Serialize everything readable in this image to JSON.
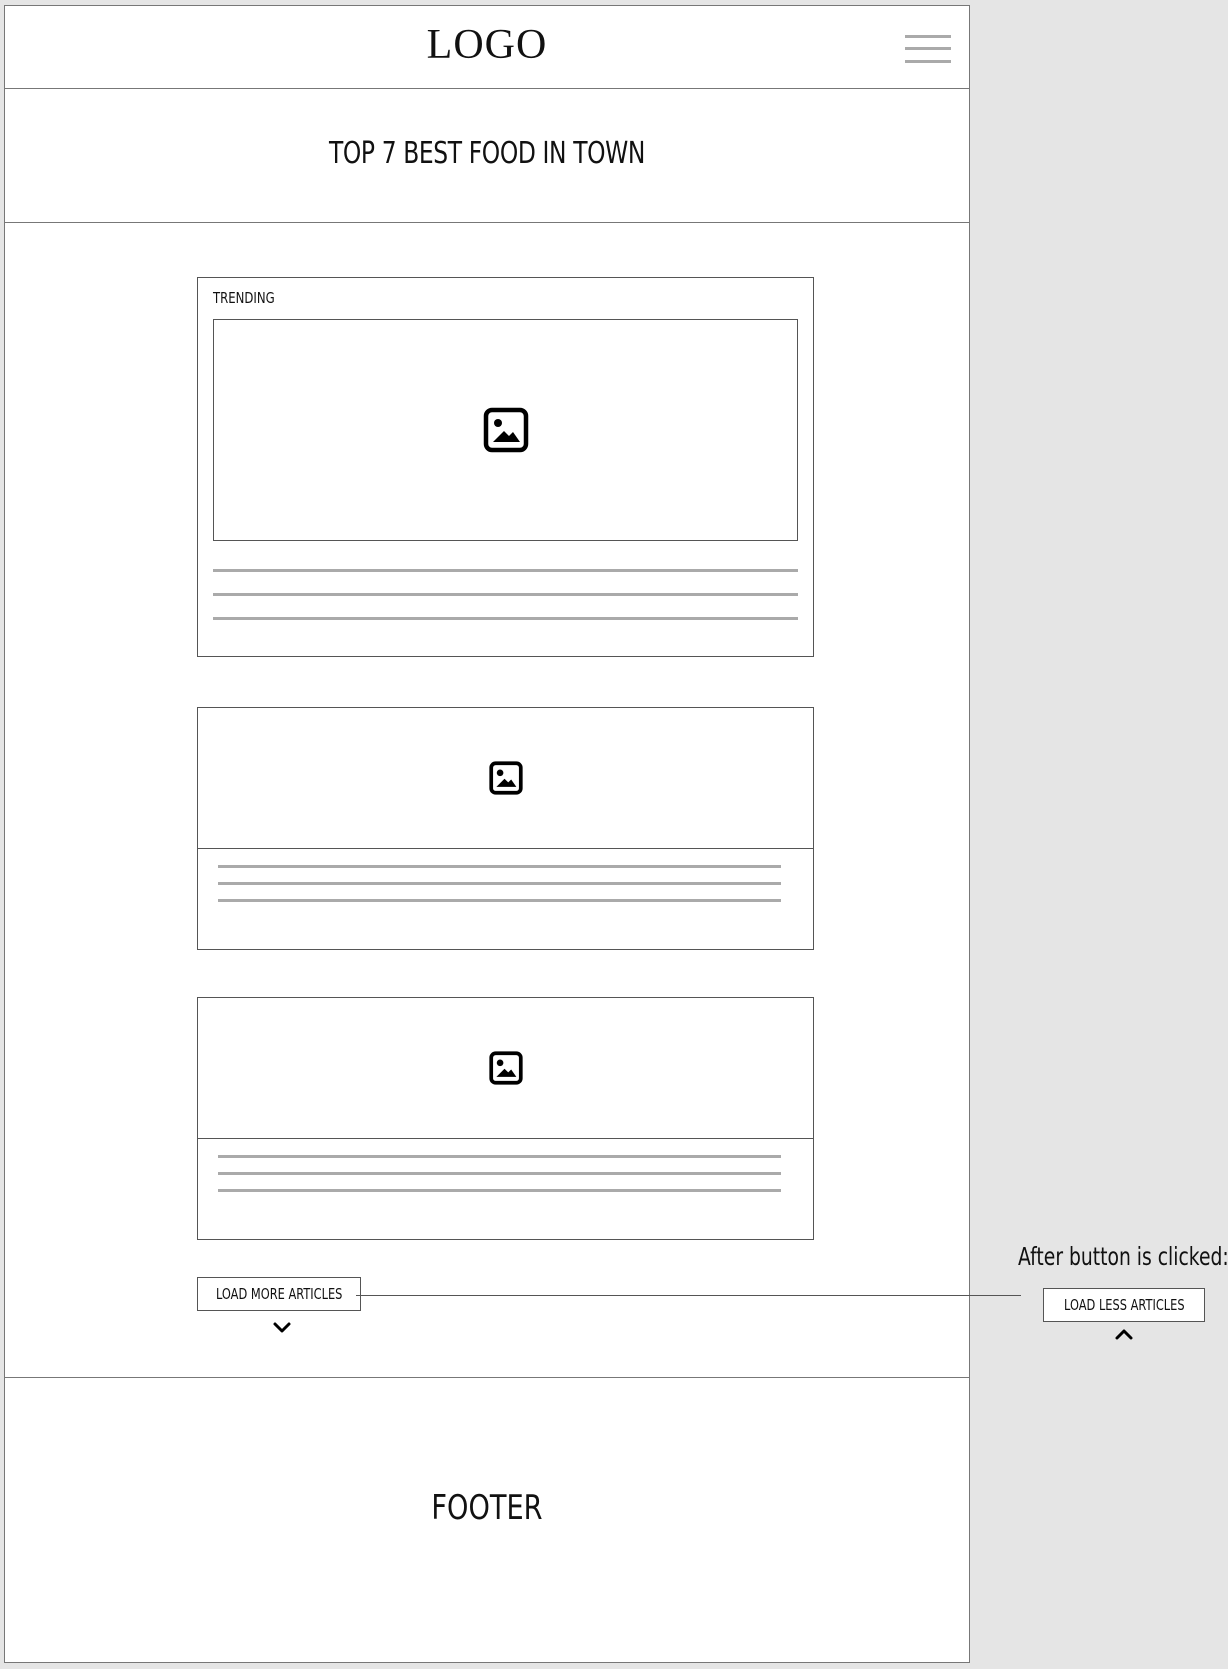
{
  "header": {
    "logo_text": "LOGO",
    "menu_icon": "hamburger-menu-icon"
  },
  "title_band": {
    "title": "TOP 7 BEST FOOD IN TOWN"
  },
  "trending_card": {
    "label": "TRENDING",
    "image_icon": "image-placeholder-icon",
    "text_lines": 3
  },
  "articles": [
    {
      "image_icon": "image-placeholder-icon",
      "text_lines": 3
    },
    {
      "image_icon": "image-placeholder-icon",
      "text_lines": 3
    }
  ],
  "load_more": {
    "label": "LOAD MORE ARTICLES",
    "icon": "chevron-down-icon"
  },
  "footer": {
    "label": "FOOTER"
  },
  "annotation": {
    "note": "After button is clicked:",
    "button_label": "LOAD LESS ARTICLES",
    "icon": "chevron-up-icon"
  },
  "colors": {
    "canvas": "#e5e5e5",
    "page": "#ffffff",
    "border": "#555555",
    "placeholder_line": "#aaaaaa"
  }
}
